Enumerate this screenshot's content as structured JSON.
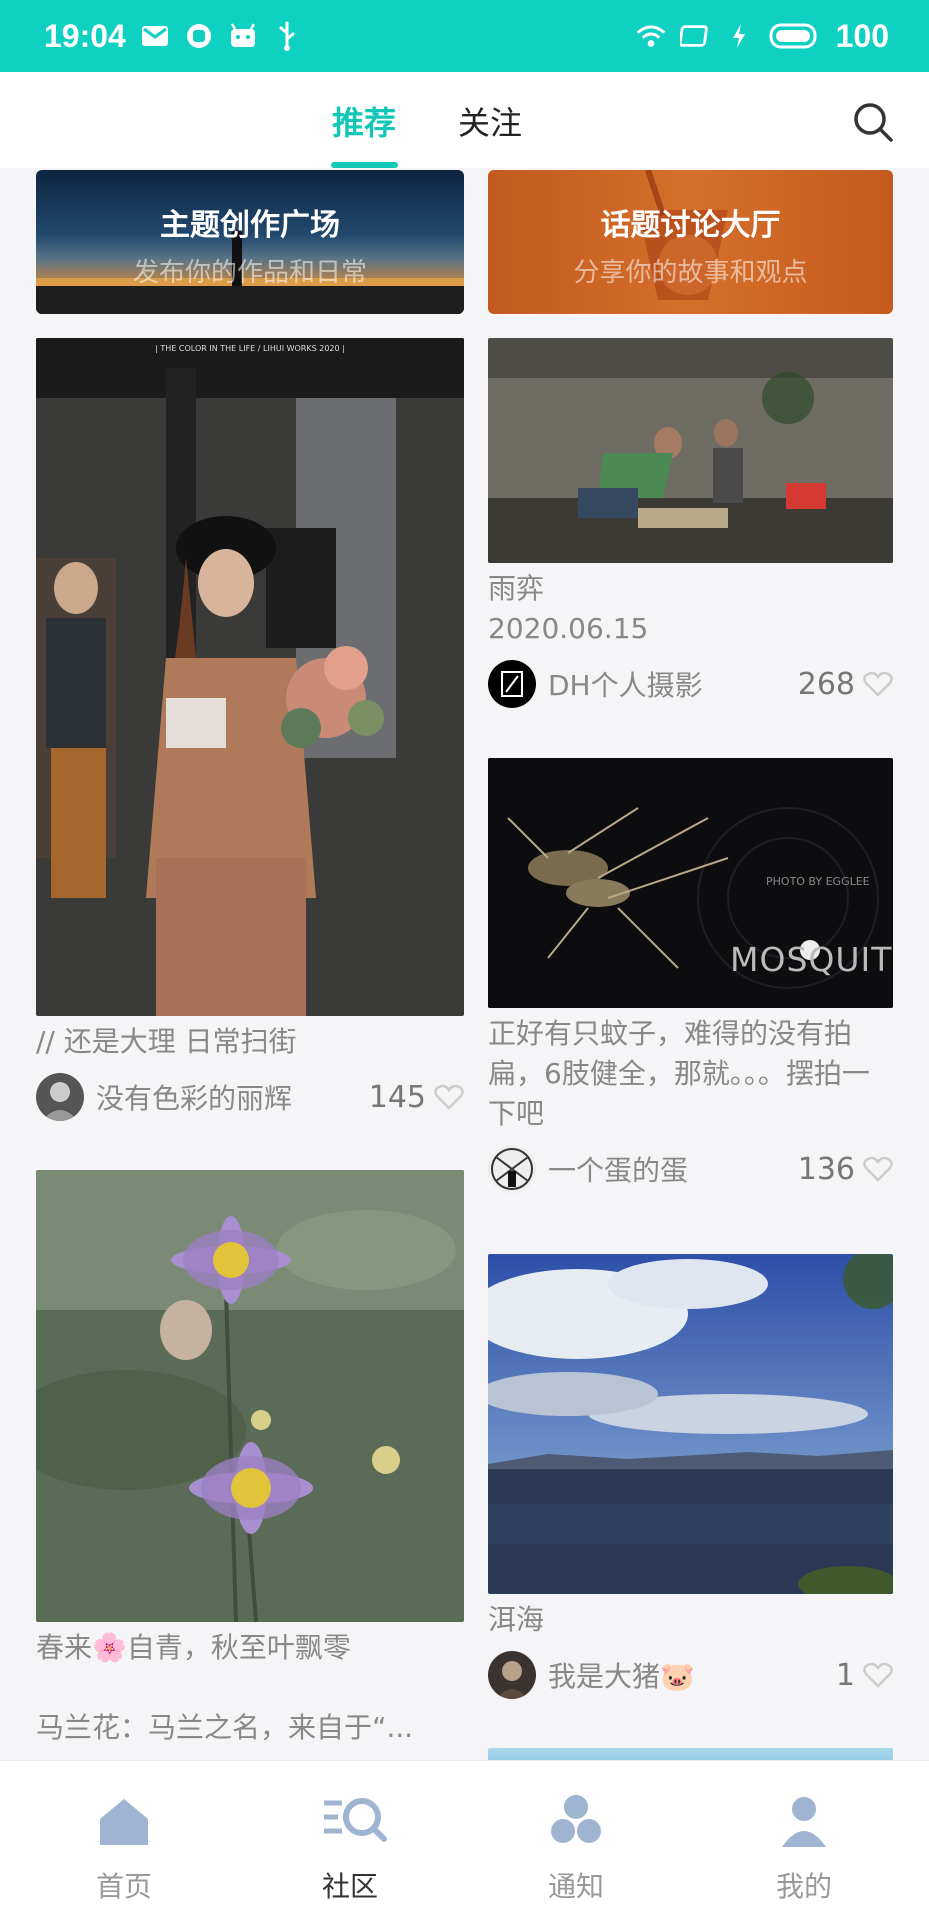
{
  "status_bar": {
    "time": "19:04",
    "battery": "100"
  },
  "top_nav": {
    "tabs": [
      "推荐",
      "关注"
    ],
    "active_tab": "推荐"
  },
  "banners": [
    {
      "title": "主题创作广场",
      "subtitle": "发布你的作品和日常"
    },
    {
      "title": "话题讨论大厅",
      "subtitle": "分享你的故事和观点"
    }
  ],
  "posts": [
    {
      "title": "// 还是大理 日常扫街",
      "author": "没有色彩的丽辉",
      "likes": "145",
      "image_caption": "| THE COLOR IN THE LIFE / LIHUI WORKS 2020 |"
    },
    {
      "title": "雨弈\n2020.06.15",
      "author": "DH个人摄影",
      "likes": "268"
    },
    {
      "title": "正好有只蚊子，难得的没有拍扁，6肢健全，那就。。。摆拍一下吧",
      "author": "一个蛋的蛋",
      "likes": "136",
      "image_caption": "PHOTO BY EGGLEE",
      "image_text": "MOSQUITO"
    },
    {
      "title": "春来🌸自青，秋至叶飘零\n\n马兰花：马兰之名，来自于“..."
    },
    {
      "title": "洱海",
      "author": "我是大猪🐷",
      "likes": "1"
    }
  ],
  "bottom_nav": {
    "items": [
      "首页",
      "社区",
      "通知",
      "我的"
    ],
    "active": "社区"
  },
  "colors": {
    "accent": "#13c7b8",
    "status_bar": "#0fd1c1"
  }
}
